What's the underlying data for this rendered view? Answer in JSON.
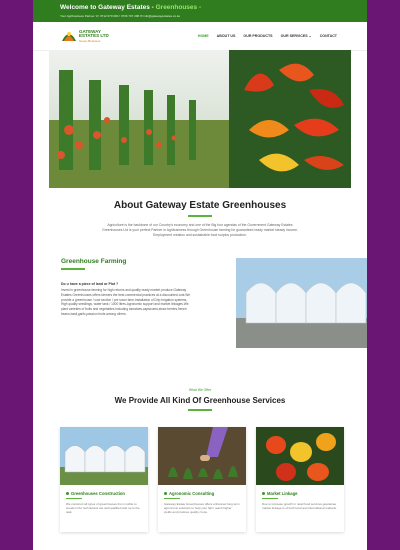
{
  "topbar": {
    "title_main": "Welcome to Gateway Estates - ",
    "title_accent": "Greenhouses -",
    "info": "Your Agribusiness Partner   ☏  0712 070 000 / 0736 707 296   ✉  info@gatewayestates.co.ke"
  },
  "logo": {
    "line1": "GATEWAY ESTATES LTD",
    "line2": "Green Business"
  },
  "nav": {
    "home": "HOME",
    "about": "ABOUT US",
    "products": "OUR PRODUCTS",
    "services": "OUR SERVICES ⌄",
    "contact": "CONTACT"
  },
  "about": {
    "title": "About Gateway Estate Greenhouses",
    "text": "Agriculture is the backbone of our Country's economy and one of the Big four agendas of the Government.Gateway Estates Greenhouses Ltd is your perfect Partner in Agribusiness through Greenhouse farming for guaranteed ready market steady income, Employment creation and sustainable food surplus production."
  },
  "farming": {
    "title": "Greenhouse Farming",
    "question": "Do u have a piece of land or Plot ?",
    "text": "Invest in greenhouse farming for high returns and quality ready market produce.Gateway Estates Greenhouses offers farmers the best commercial practices at a discounted cost.We provide a greenhouse / cow section / pre sown farm,Installation of Drip Irrigation systems, High quality seedlings, water tank / 1000 litres,Agronomic support and market linkages.We plant varieties of fruits and vegetables including tomatoes,capsicums,straw berries,french beans,basil,garlic,passion fruits among others."
  },
  "offer": {
    "small": "What We Offer",
    "title": "We Provide All Kind Of Greenhouse Services"
  },
  "cards": [
    {
      "title": "Greenhouses Construction",
      "text": "We construct all types of greenhouses from mobile to wooden.Our technicians are well qualified and up to the task."
    },
    {
      "title": "Agronomic Consulting",
      "text": "Gateway Estate Greenhouses offers enhanced long term agronomic solutions to help your farm reach higher yields and produce quality crops."
    },
    {
      "title": "Market Linkage",
      "text": "Due to increase growth in retail food services,guarantee market linkage is of both local and international markets."
    }
  ],
  "colors": {
    "brand_green": "#2f7d1f",
    "accent_green": "#5cb33c",
    "page_bg": "#6a1674"
  }
}
